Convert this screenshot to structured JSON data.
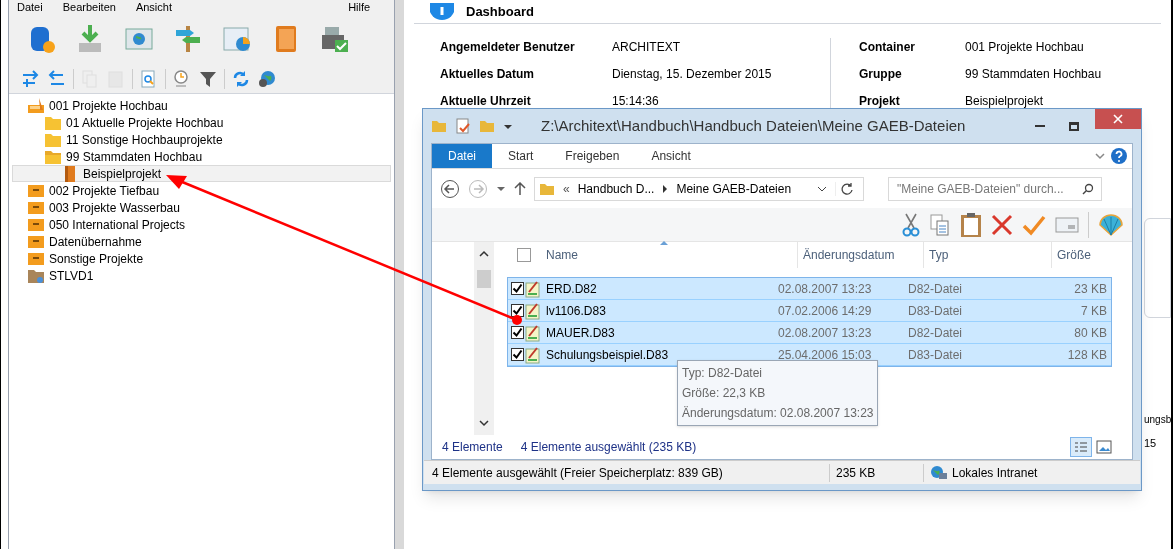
{
  "menu": [
    "Datei",
    "Bearbeiten",
    "Ansicht",
    "Hilfe"
  ],
  "toolbar_large": [
    {
      "kind": "database"
    },
    {
      "kind": "download"
    },
    {
      "kind": "globe-window"
    },
    {
      "kind": "signpost"
    },
    {
      "kind": "chart"
    },
    {
      "kind": "book"
    },
    {
      "kind": "register"
    }
  ],
  "toolbar_small": [
    {
      "kind": "indent",
      "disabled": false
    },
    {
      "kind": "outdent",
      "disabled": false
    },
    {
      "kind": "copy",
      "disabled": true
    },
    {
      "kind": "paste",
      "disabled": true
    },
    {
      "kind": "search",
      "disabled": false
    },
    {
      "kind": "clock",
      "disabled": false
    },
    {
      "kind": "filter",
      "disabled": false
    },
    {
      "kind": "sync",
      "disabled": false
    },
    {
      "kind": "globe",
      "disabled": false
    }
  ],
  "tree": [
    {
      "label": "001 Projekte Hochbau",
      "kind": "open-drawer",
      "selected": false,
      "children": [
        {
          "label": "01 Aktuelle Projekte Hochbau",
          "kind": "folder",
          "selected": false
        },
        {
          "label": "11 Sonstige Hochbauprojekte",
          "kind": "folder",
          "selected": false
        },
        {
          "label": "99 Stammdaten Hochbau",
          "kind": "open-folder",
          "selected": false,
          "children": [
            {
              "label": "Beispielprojekt",
              "kind": "project",
              "selected": true
            }
          ]
        }
      ]
    },
    {
      "label": "002 Projekte Tiefbau",
      "kind": "drawer",
      "selected": false
    },
    {
      "label": "003 Projekte Wasserbau",
      "kind": "drawer",
      "selected": false
    },
    {
      "label": "050 International Projects",
      "kind": "drawer",
      "selected": false
    },
    {
      "label": "Datenübernahme",
      "kind": "drawer",
      "selected": false
    },
    {
      "label": "Sonstige Projekte",
      "kind": "drawer",
      "selected": false
    },
    {
      "label": "STLVD1",
      "kind": "archive",
      "selected": false
    }
  ],
  "dashboard": {
    "title": "Dashboard",
    "info_left": [
      {
        "label": "Angemeldeter Benutzer",
        "value": "ARCHITEXT"
      },
      {
        "label": "Aktuelles Datum",
        "value": "Dienstag, 15. Dezember 2015"
      },
      {
        "label": "Aktuelle Uhrzeit",
        "value": "15:14:36"
      }
    ],
    "info_right": [
      {
        "label": "Container",
        "value": "001 Projekte Hochbau"
      },
      {
        "label": "Gruppe",
        "value": "99 Stammdaten Hochbau"
      },
      {
        "label": "Projekt",
        "value": "Beispielprojekt"
      }
    ],
    "fragments": [
      "ungsb",
      "15"
    ]
  },
  "explorer": {
    "title": "Z:\\Architext\\Handbuch\\Handbuch Dateien\\Meine GAEB-Dateien",
    "tabs": [
      {
        "label": "Datei",
        "selected": true
      },
      {
        "label": "Start",
        "selected": false
      },
      {
        "label": "Freigeben",
        "selected": false
      },
      {
        "label": "Ansicht",
        "selected": false
      }
    ],
    "breadcrumb": [
      "«",
      "Handbuch D...",
      "Meine GAEB-Dateien"
    ],
    "search": {
      "placeholder": "\"Meine GAEB-Dateien\" durch..."
    },
    "columns": [
      "Name",
      "Änderungsdatum",
      "Typ",
      "Größe"
    ],
    "select_all_checked": false,
    "rows": [
      {
        "name": "ERD.D82",
        "date": "02.08.2007 13:23",
        "type": "D82-Datei",
        "size": "23 KB",
        "checked": true,
        "selected": true
      },
      {
        "name": "lv1106.D83",
        "date": "07.02.2006 14:29",
        "type": "D83-Datei",
        "size": "7 KB",
        "checked": true,
        "selected": true
      },
      {
        "name": "MAUER.D83",
        "date": "02.08.2007 13:23",
        "type": "D82-Datei",
        "size": "80 KB",
        "checked": true,
        "selected": true
      },
      {
        "name": "Schulungsbeispiel.D83",
        "date": "25.04.2006 15:03",
        "type": "D83-Datei",
        "size": "128 KB",
        "checked": true,
        "selected": true
      }
    ],
    "tooltip": [
      "Typ: D82-Datei",
      "Größe: 22,3 KB",
      "Änderungsdatum: 02.08.2007 13:23"
    ],
    "footer": [
      "4 Elemente",
      "4 Elemente ausgewählt (235 KB)"
    ],
    "status": [
      "4 Elemente ausgewählt (Freier Speicherplatz: 839 GB)",
      "235 KB",
      "Lokales Intranet"
    ]
  }
}
